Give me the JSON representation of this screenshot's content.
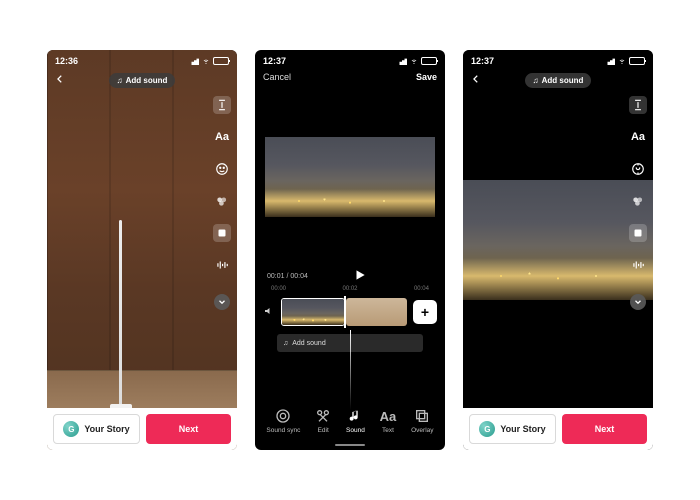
{
  "screen1": {
    "status": {
      "time": "12:36"
    },
    "add_sound": "Add sound",
    "side_tools": {
      "text": "Aa"
    },
    "bottom": {
      "story": "Your Story",
      "story_initial": "G",
      "next": "Next"
    }
  },
  "screen2": {
    "status": {
      "time": "12:37"
    },
    "top": {
      "cancel": "Cancel",
      "save": "Save"
    },
    "time": {
      "current": "00:01",
      "total": "00:04"
    },
    "ticks": {
      "t1": "00:00",
      "t2": "00:02",
      "t3": "00:04"
    },
    "add_sound_strip": "Add sound",
    "tools": {
      "sound_sync": "Sound sync",
      "edit": "Edit",
      "sound": "Sound",
      "text": "Text",
      "overlay": "Overlay",
      "text_glyph": "Aa"
    }
  },
  "screen3": {
    "status": {
      "time": "12:37"
    },
    "add_sound": "Add sound",
    "side_tools": {
      "text": "Aa"
    },
    "bottom": {
      "story": "Your Story",
      "story_initial": "G",
      "next": "Next"
    }
  }
}
